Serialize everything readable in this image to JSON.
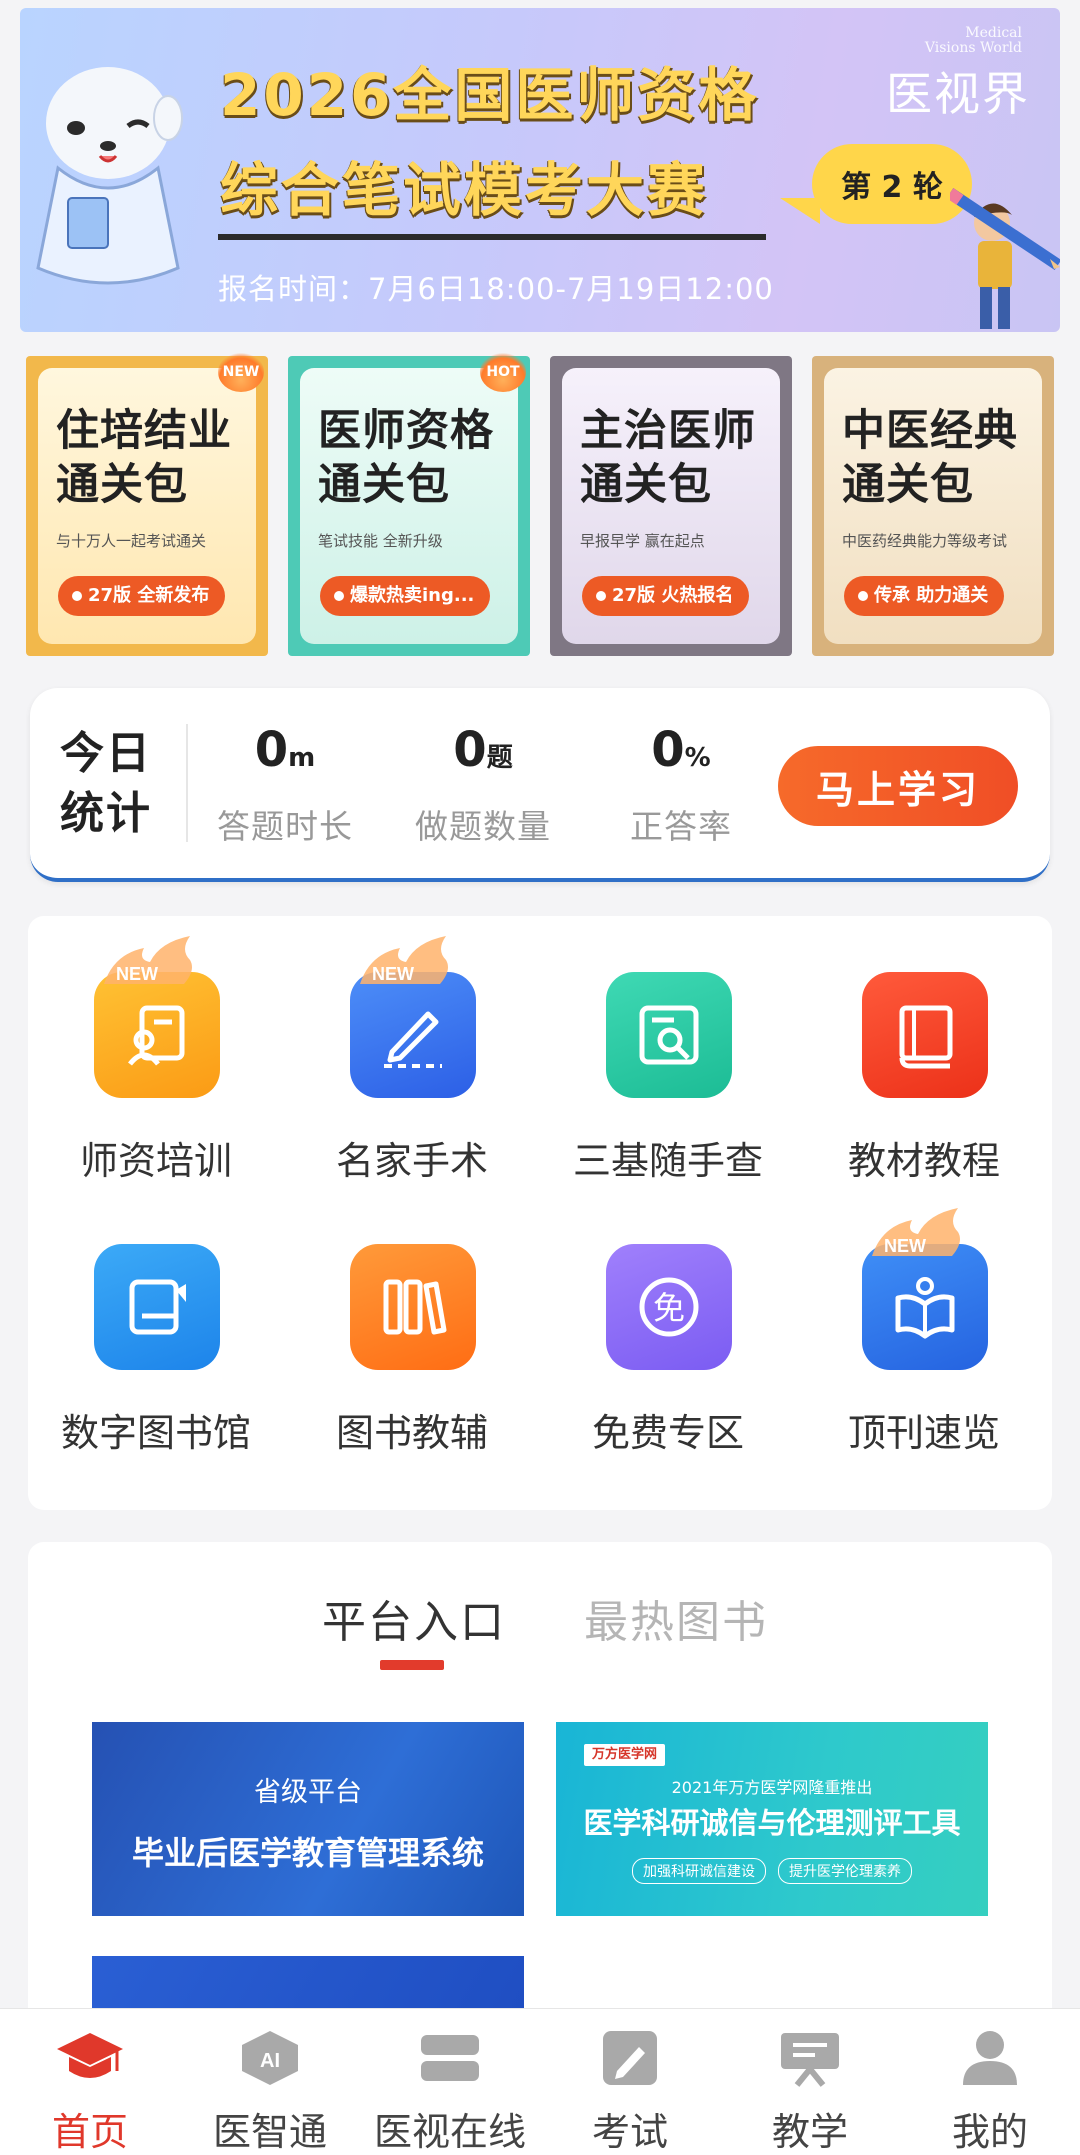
{
  "banner": {
    "brand_sub_1": "Medical",
    "brand_sub_2": "Visions World",
    "brand": "医视界",
    "title_line1": "2026全国医师资格",
    "title_line2": "综合笔试模考大赛",
    "round": "第 2 轮",
    "date": "报名时间：7月6日18:00-7月19日12:00"
  },
  "packs": [
    {
      "title1": "住培结业",
      "title2": "通关包",
      "sub": "与十万人一起考试通关",
      "pill": "27版 全新发布",
      "tag": "NEW"
    },
    {
      "title1": "医师资格",
      "title2": "通关包",
      "sub": "笔试技能 全新升级",
      "pill": "爆款热卖ing...",
      "tag": "HOT"
    },
    {
      "title1": "主治医师",
      "title2": "通关包",
      "sub": "早报早学 赢在起点",
      "pill": "27版 火热报名",
      "tag": ""
    },
    {
      "title1": "中医经典",
      "title2": "通关包",
      "sub": "中医药经典能力等级考试",
      "pill": "传承 助力通关",
      "tag": ""
    }
  ],
  "stats": {
    "today_1": "今日",
    "today_2": "统计",
    "duration_value": "0",
    "duration_unit": "m",
    "duration_label": "答题时长",
    "count_value": "0",
    "count_unit": "题",
    "count_label": "做题数量",
    "rate_value": "0",
    "rate_unit": "%",
    "rate_label": "正答率",
    "start_button": "马上学习"
  },
  "features": [
    {
      "label": "师资培训",
      "icon": "teacher-training-icon",
      "new": true
    },
    {
      "label": "名家手术",
      "icon": "surgery-pen-icon",
      "new": true
    },
    {
      "label": "三基随手查",
      "icon": "search-document-icon",
      "new": false
    },
    {
      "label": "教材教程",
      "icon": "textbook-icon",
      "new": false
    },
    {
      "label": "数字图书馆",
      "icon": "digital-library-icon",
      "new": false
    },
    {
      "label": "图书教辅",
      "icon": "books-icon",
      "new": false
    },
    {
      "label": "免费专区",
      "icon": "free-zone-icon",
      "new": false
    },
    {
      "label": "顶刊速览",
      "icon": "journal-reader-icon",
      "new": true
    }
  ],
  "new_badge": "NEW",
  "platform": {
    "tab_entry": "平台入口",
    "tab_hot_books": "最热图书",
    "card1_line1": "省级平台",
    "card1_line2": "毕业后医学教育管理系统",
    "card2_logo": "万方医学网",
    "card2_line1": "2021年万方医学网隆重推出",
    "card2_line2": "医学科研诚信与伦理测评工具",
    "card2_chip1": "加强科研诚信建设",
    "card2_chip2": "提升医学伦理素养"
  },
  "nav": [
    {
      "label": "首页",
      "icon": "graduation-cap-icon",
      "active": true
    },
    {
      "label": "医智通",
      "icon": "ai-icon",
      "active": false
    },
    {
      "label": "医视在线",
      "icon": "online-video-icon",
      "active": false
    },
    {
      "label": "考试",
      "icon": "exam-pen-icon",
      "active": false
    },
    {
      "label": "教学",
      "icon": "teaching-board-icon",
      "active": false
    },
    {
      "label": "我的",
      "icon": "user-profile-icon",
      "active": false
    }
  ],
  "colors": {
    "accent": "#e0382b",
    "button_orange": "#f25a28",
    "inactive": "#9a9a9a"
  }
}
